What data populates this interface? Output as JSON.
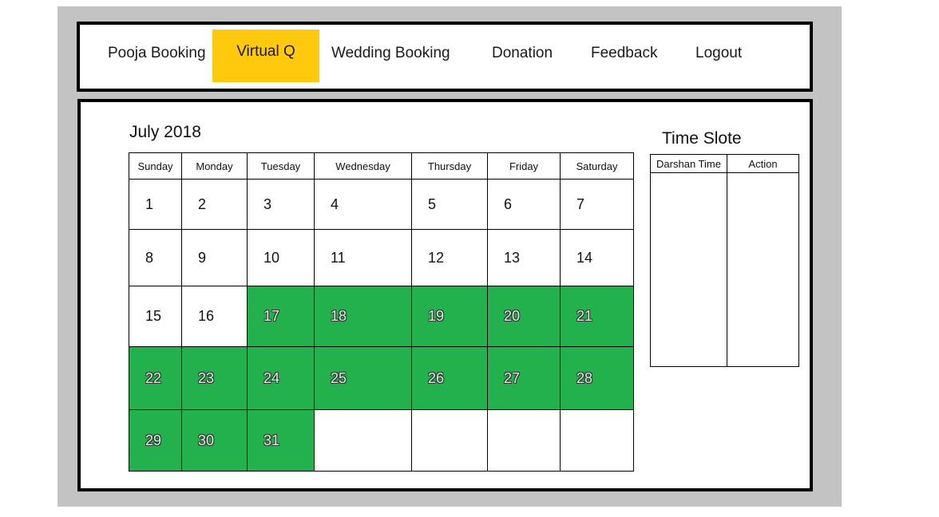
{
  "nav": {
    "items": [
      {
        "label": "Pooja Booking",
        "active": false
      },
      {
        "label": "Virtual Q",
        "active": true
      },
      {
        "label": "Wedding Booking",
        "active": false
      },
      {
        "label": "Donation",
        "active": false
      },
      {
        "label": "Feedback",
        "active": false
      },
      {
        "label": "Logout",
        "active": false
      }
    ],
    "active_color": "#ffc90e"
  },
  "calendar": {
    "title": "July 2018",
    "weekdays": [
      "Sunday",
      "Monday",
      "Tuesday",
      "Wednesday",
      "Thursday",
      "Friday",
      "Saturday"
    ],
    "weeks": [
      [
        "1",
        "2",
        "3",
        "4",
        "5",
        "6",
        "7"
      ],
      [
        "8",
        "9",
        "10",
        "11",
        "12",
        "13",
        "14"
      ],
      [
        "15",
        "16",
        "17",
        "18",
        "19",
        "20",
        "21"
      ],
      [
        "22",
        "23",
        "24",
        "25",
        "26",
        "27",
        "28"
      ],
      [
        "29",
        "30",
        "31",
        "",
        "",
        "",
        ""
      ]
    ],
    "available_days": [
      "17",
      "18",
      "19",
      "20",
      "21",
      "22",
      "23",
      "24",
      "25",
      "26",
      "27",
      "28",
      "29",
      "30",
      "31"
    ],
    "available_color": "#22b14c"
  },
  "time_slot": {
    "title": "Time Slote",
    "columns": [
      "Darshan Time",
      "Action"
    ]
  }
}
